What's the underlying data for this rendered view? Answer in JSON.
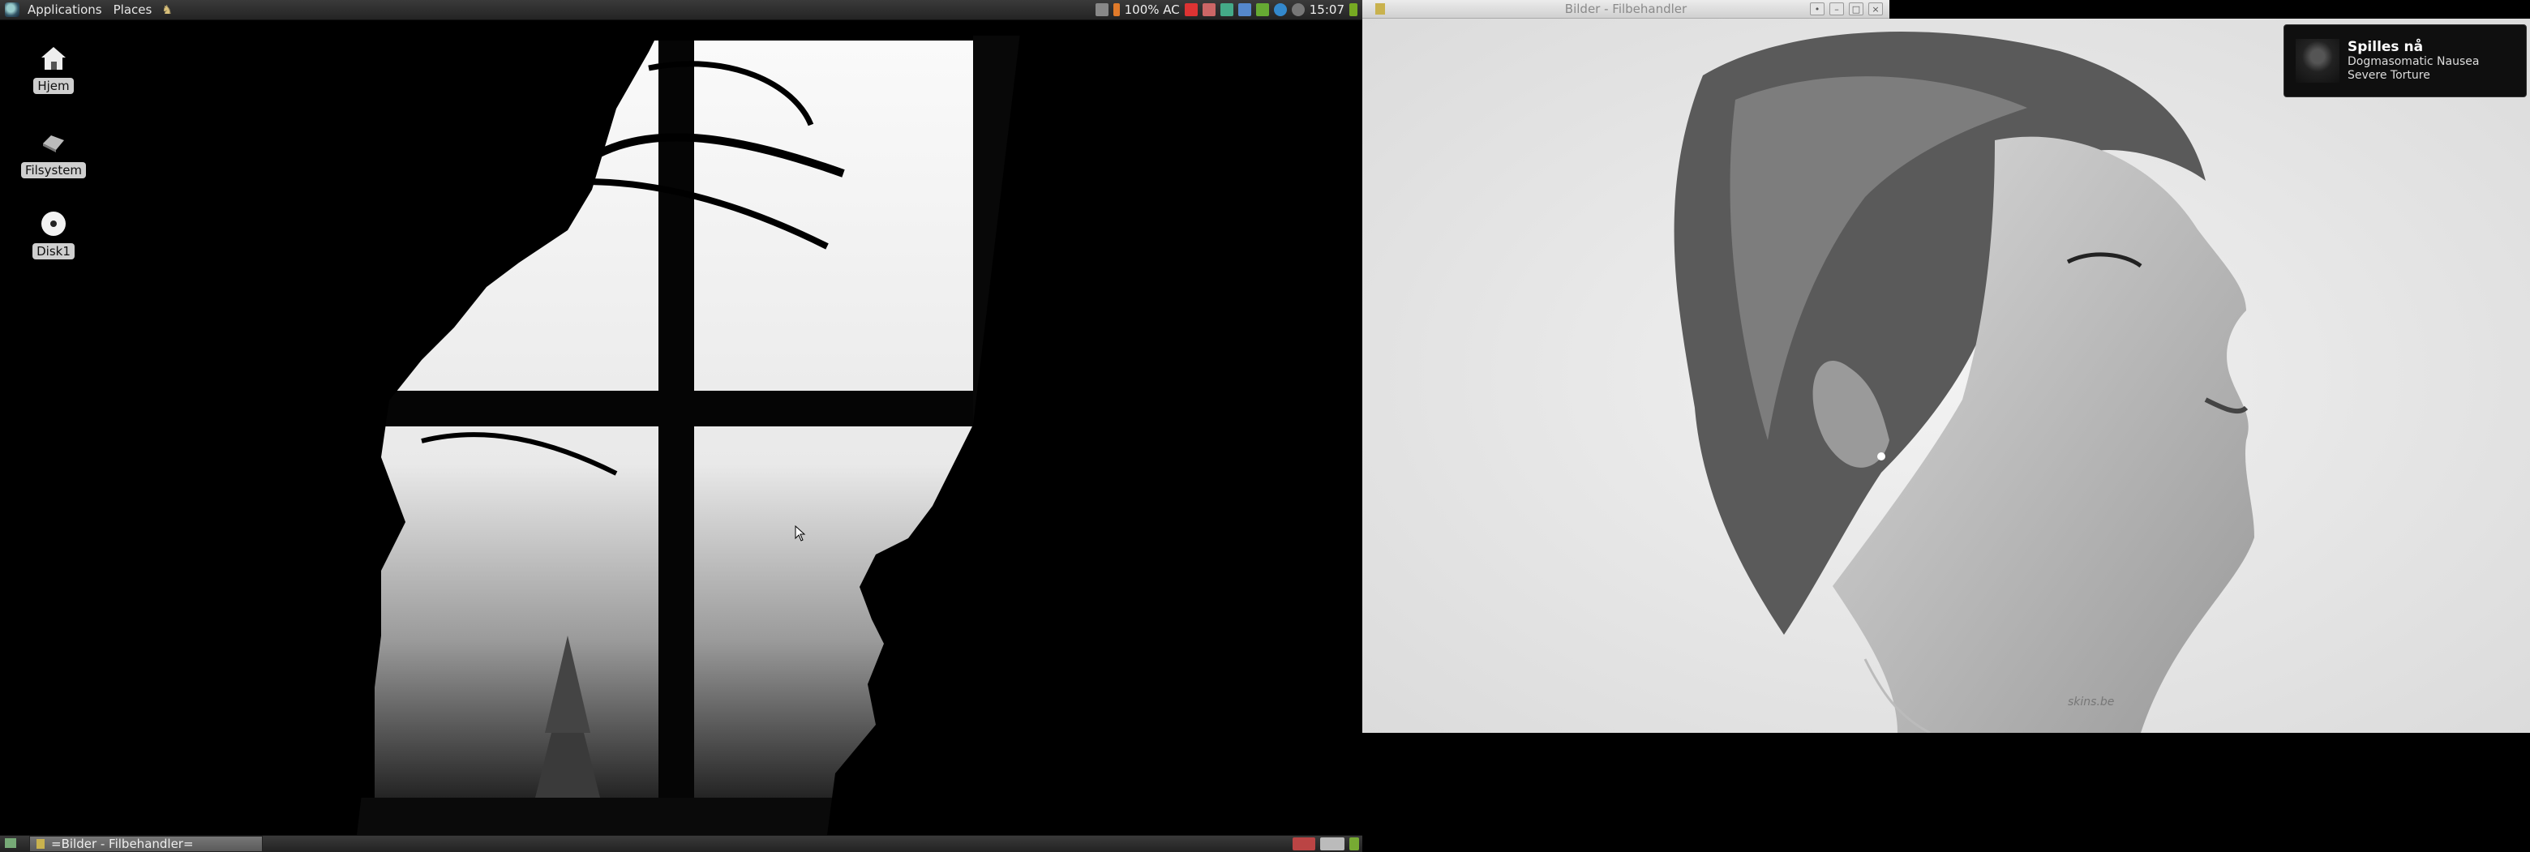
{
  "top_panel": {
    "menus": [
      "Applications",
      "Places"
    ],
    "tray": {
      "battery": "100% AC",
      "clock": "15:07"
    }
  },
  "desktop_icons": [
    {
      "label": "Hjem",
      "icon": "home-icon"
    },
    {
      "label": "Filsystem",
      "icon": "drive-icon"
    },
    {
      "label": "Disk1",
      "icon": "disc-icon"
    }
  ],
  "window": {
    "title": "Bilder - Filbehandler",
    "watermark": "skins.be"
  },
  "notification": {
    "title": "Spilles nå",
    "artist": "Dogmasomatic Nausea",
    "track": "Severe Torture"
  },
  "taskbar": {
    "task_label": "=Bilder - Filbehandler="
  },
  "colors": {
    "panel": "#2e2e2e",
    "window_title_bg": "#dcdcdc",
    "task_bg": "#666666"
  }
}
